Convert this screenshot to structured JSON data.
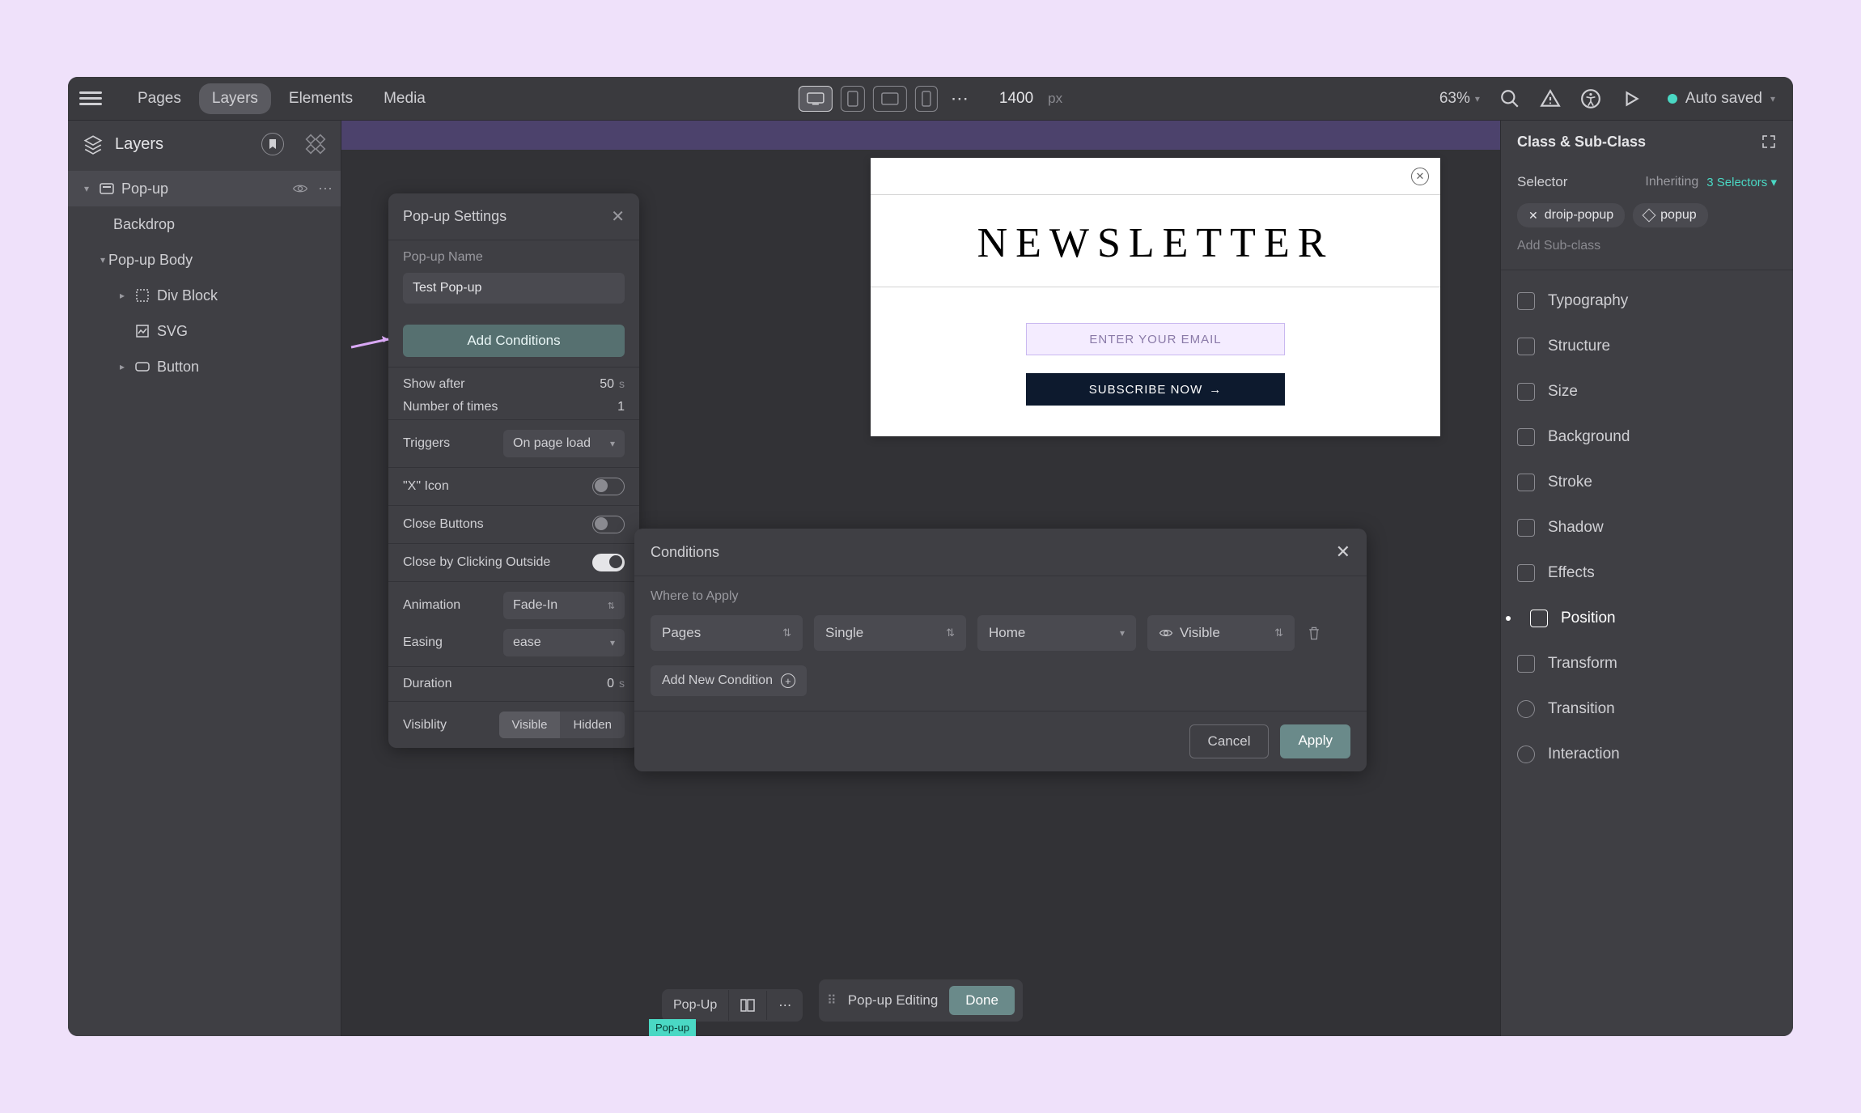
{
  "topbar": {
    "tabs": {
      "pages": "Pages",
      "layers": "Layers",
      "elements": "Elements",
      "media": "Media"
    },
    "active_tab": "layers",
    "canvas_width": "1400",
    "canvas_unit": "px",
    "zoom": "63%",
    "save_status": "Auto saved"
  },
  "layers_panel": {
    "title": "Layers",
    "tree": {
      "root": "Pop-up",
      "backdrop": "Backdrop",
      "body": "Pop-up Body",
      "div": "Div Block",
      "svg": "SVG",
      "button": "Button"
    }
  },
  "settings": {
    "title": "Pop-up Settings",
    "name_label": "Pop-up Name",
    "name_value": "Test Pop-up",
    "add_conditions": "Add Conditions",
    "show_after_label": "Show after",
    "show_after_value": "50",
    "show_after_unit": "s",
    "num_times_label": "Number of times",
    "num_times_value": "1",
    "triggers_label": "Triggers",
    "triggers_value": "On page load",
    "x_icon_label": "\"X\" Icon",
    "close_buttons_label": "Close Buttons",
    "close_outside_label": "Close by Clicking Outside",
    "animation_label": "Animation",
    "animation_value": "Fade-In",
    "easing_label": "Easing",
    "easing_value": "ease",
    "duration_label": "Duration",
    "duration_value": "0",
    "duration_unit": "s",
    "visibility_label": "Visiblity",
    "visibility_visible": "Visible",
    "visibility_hidden": "Hidden"
  },
  "conditions": {
    "title": "Conditions",
    "where_label": "Where to Apply",
    "sel1": "Pages",
    "sel2": "Single",
    "sel3": "Home",
    "sel4": "Visible",
    "add_new": "Add New Condition",
    "cancel": "Cancel",
    "apply": "Apply"
  },
  "newsletter": {
    "title": "NEWSLETTER",
    "placeholder": "ENTER YOUR EMAIL",
    "button": "SUBSCRIBE NOW"
  },
  "right_panel": {
    "title": "Class & Sub-Class",
    "selector_label": "Selector",
    "inheriting": "Inheriting",
    "selector_count": "3 Selectors",
    "chip1": "droip-popup",
    "chip2": "popup",
    "add_sub": "Add Sub-class",
    "props": {
      "typography": "Typography",
      "structure": "Structure",
      "size": "Size",
      "background": "Background",
      "stroke": "Stroke",
      "shadow": "Shadow",
      "effects": "Effects",
      "position": "Position",
      "transform": "Transform",
      "transition": "Transition",
      "interaction": "Interaction"
    }
  },
  "bottom": {
    "popup": "Pop-Up",
    "tag": "Pop-up"
  },
  "edit_bar": {
    "label": "Pop-up Editing",
    "done": "Done"
  }
}
